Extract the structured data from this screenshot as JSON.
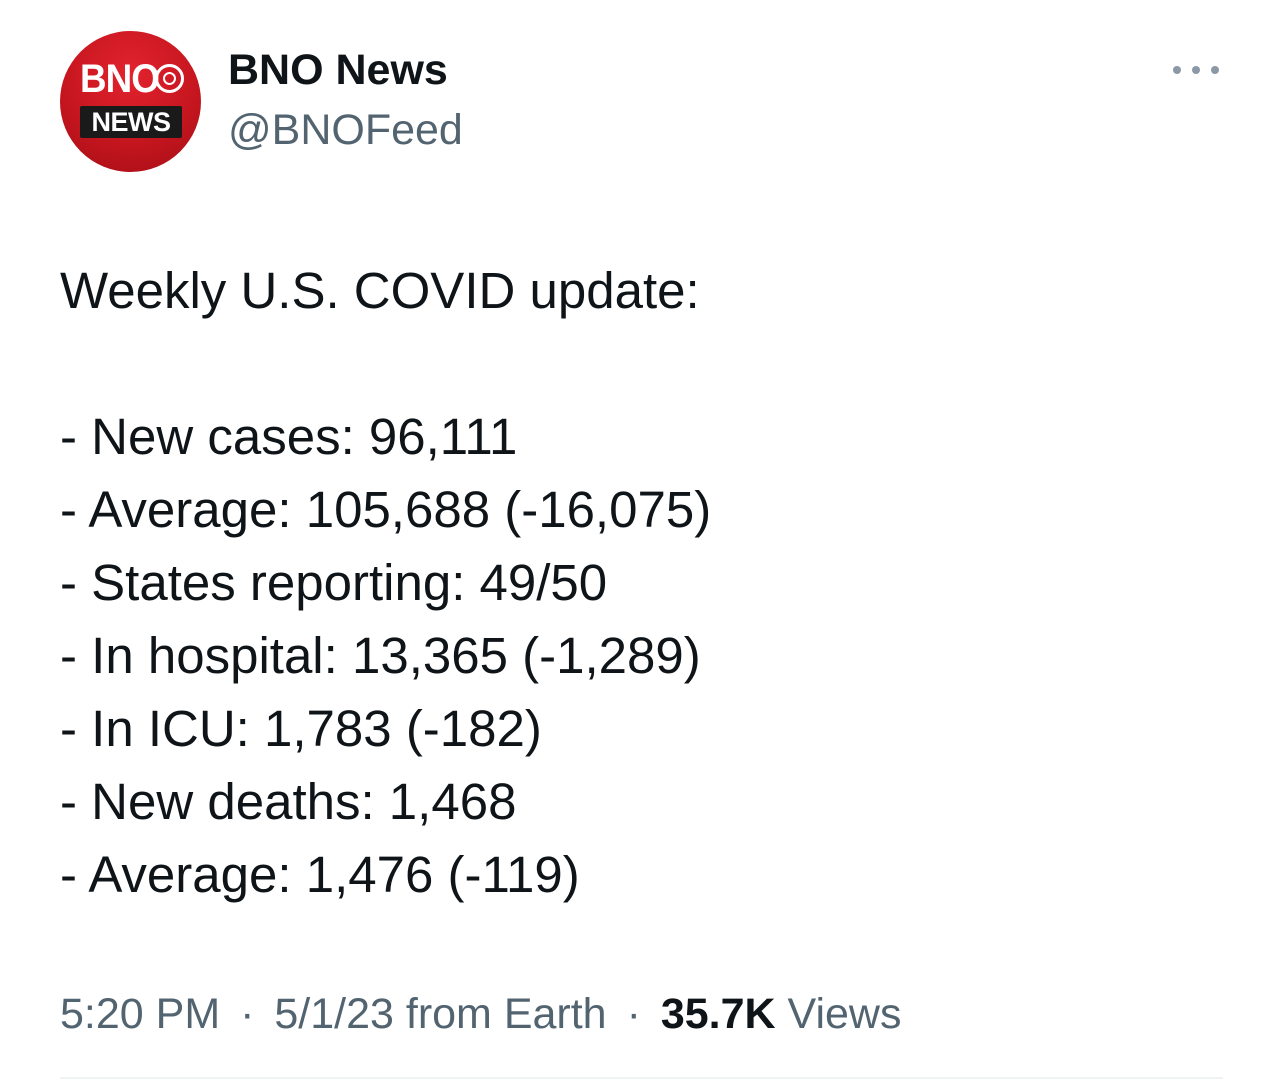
{
  "author": {
    "display_name": "BNO News",
    "handle": "@BNOFeed",
    "avatar": {
      "logo_top": "BNO",
      "logo_bottom": "NEWS",
      "icon": "globe-icon",
      "brand_color": "#c6161f"
    }
  },
  "menu": {
    "icon": "more-horizontal-icon"
  },
  "tweet": {
    "heading": "Weekly U.S. COVID update:",
    "lines": [
      "- New cases: 96,111",
      "- Average: 105,688 (-16,075)",
      "- States reporting: 49/50",
      "- In hospital: 13,365 (-1,289)",
      "- In ICU: 1,783 (-182)",
      "- New deaths: 1,468",
      "- Average: 1,476 (-119)"
    ]
  },
  "meta": {
    "time": "5:20 PM",
    "separator": "·",
    "date_source": "5/1/23 from Earth",
    "views_count": "35.7K",
    "views_label": "Views"
  },
  "colors": {
    "text_primary": "#0f1419",
    "text_secondary": "#536471",
    "divider": "#eff3f4"
  }
}
